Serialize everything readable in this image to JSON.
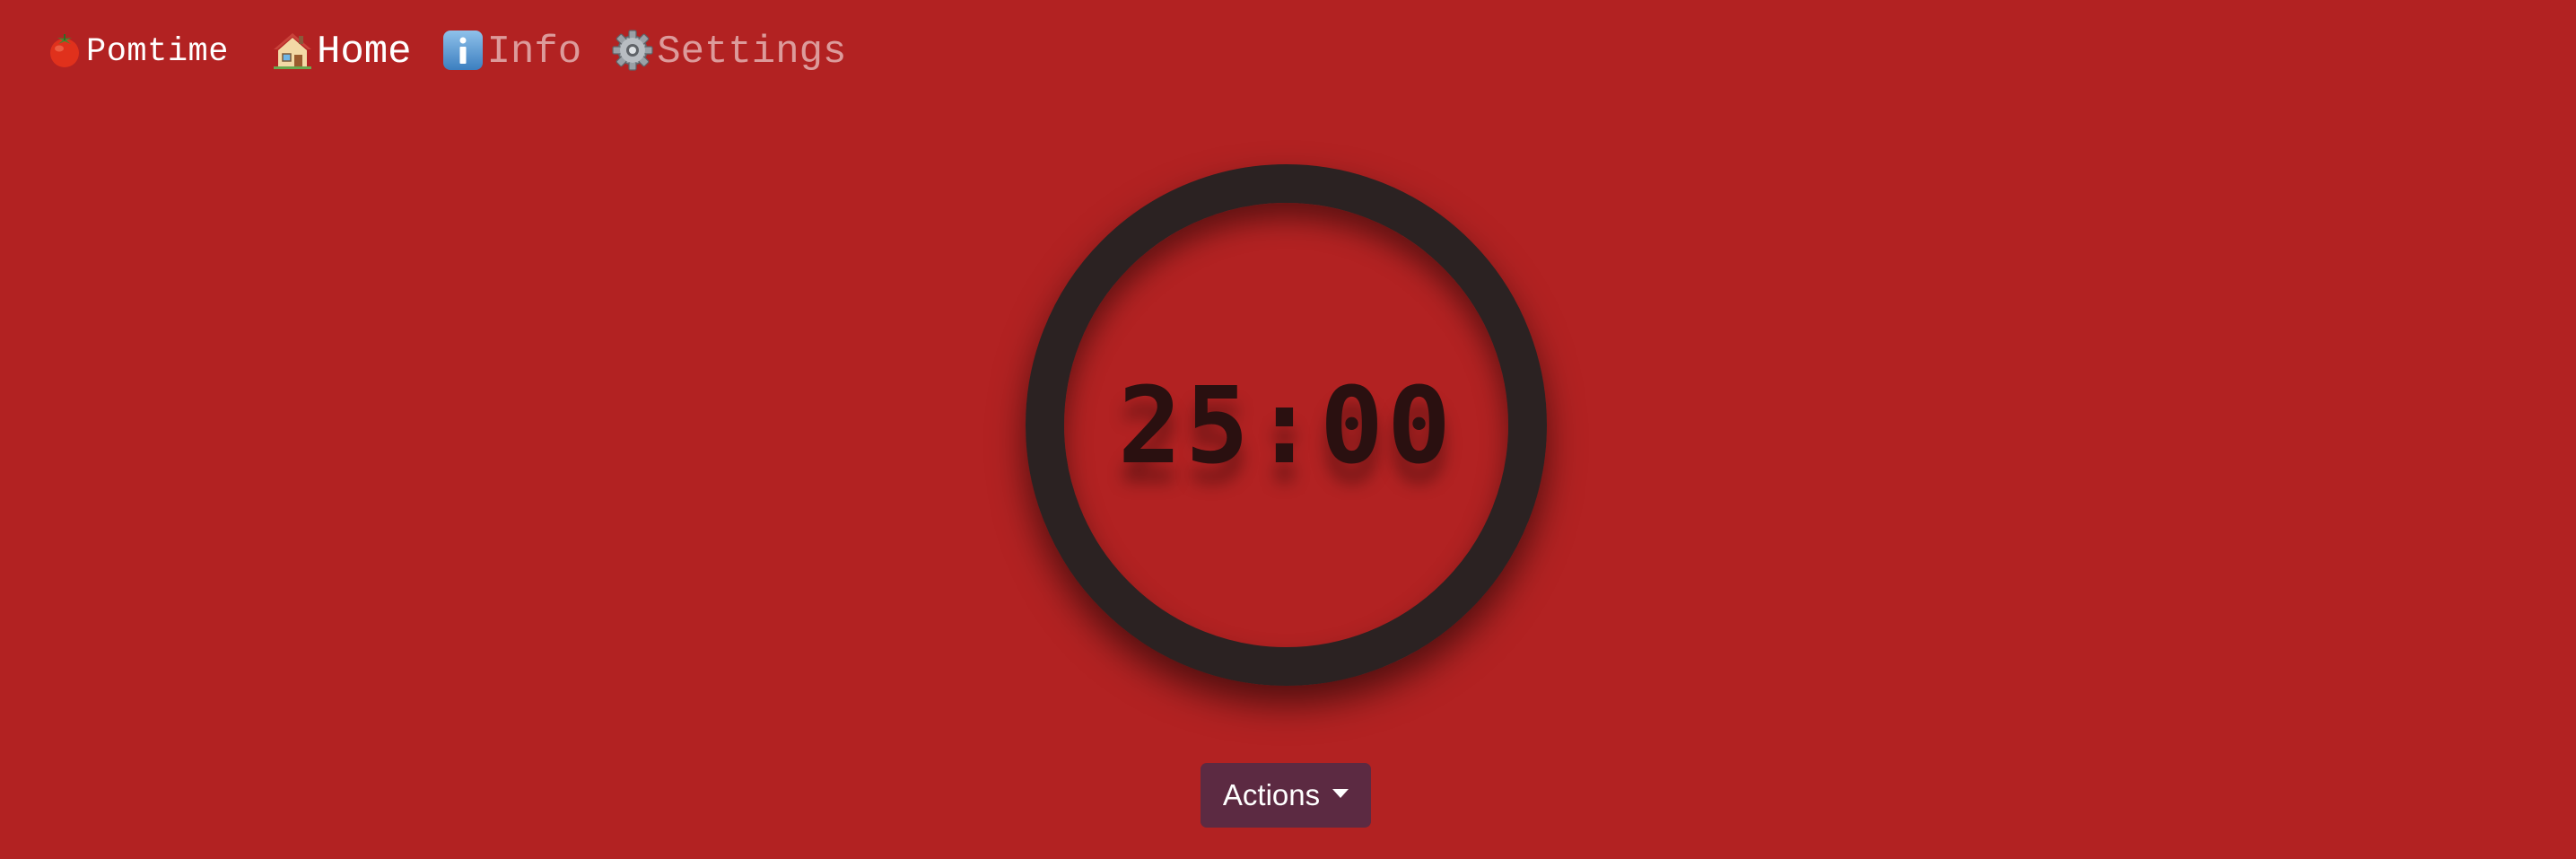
{
  "nav": {
    "brand": {
      "label": "Pomtime",
      "icon": "tomato-icon"
    },
    "links": [
      {
        "label": "Home",
        "icon": "house-icon",
        "active": true
      },
      {
        "label": "Info",
        "icon": "info-icon",
        "active": false
      },
      {
        "label": "Settings",
        "icon": "gear-icon",
        "active": false
      }
    ]
  },
  "timer": {
    "display": "25:00"
  },
  "actions": {
    "label": "Actions",
    "icon": "caret-down-icon"
  },
  "colors": {
    "background": "#b22222",
    "ring": "#2b2222",
    "timer_text": "#2a1010",
    "actions_button": "#5c2a42"
  }
}
